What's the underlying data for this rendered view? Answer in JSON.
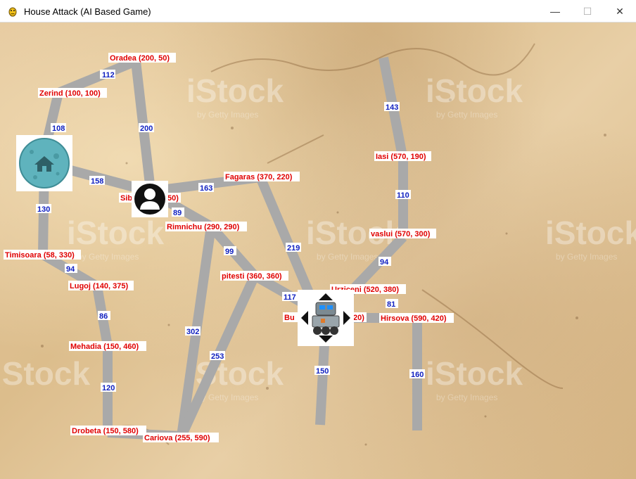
{
  "window": {
    "title": "House Attack (AI Based Game)",
    "minimize_glyph": "—",
    "maximize_glyph": "☐",
    "close_glyph": "✕"
  },
  "watermark": {
    "text": "iStock",
    "subtext": "by Getty Images"
  },
  "cities": [
    {
      "id": "oradea",
      "label": "Oradea (200, 50)"
    },
    {
      "id": "zerind",
      "label": "Zerind (100, 100)"
    },
    {
      "id": "arad",
      "label": ""
    },
    {
      "id": "sibiu",
      "label": "Sib"
    },
    {
      "id": "sibiu2",
      "label": "50)"
    },
    {
      "id": "timisoara",
      "label": "Timisoara (58, 330)"
    },
    {
      "id": "rimnichu",
      "label": "Rimnichu (290, 290)"
    },
    {
      "id": "fagaras",
      "label": "Fagaras (370, 220)"
    },
    {
      "id": "pitesti",
      "label": "pitesti (360, 360)"
    },
    {
      "id": "lugoj",
      "label": "Lugoj (140, 375)"
    },
    {
      "id": "mehadia",
      "label": "Mehadia (150, 460)"
    },
    {
      "id": "drobeta",
      "label": "Drobeta (150, 580)"
    },
    {
      "id": "cariova",
      "label": "Cariova (255, 590)"
    },
    {
      "id": "bucharest",
      "label": "Bu"
    },
    {
      "id": "bucharest2",
      "label": "20)"
    },
    {
      "id": "urziceni",
      "label": "Urziceni (520, 380)"
    },
    {
      "id": "hirsova",
      "label": "Hirsova (590, 420)"
    },
    {
      "id": "vaslui",
      "label": "vaslui (570, 300)"
    },
    {
      "id": "iasi",
      "label": "Iasi (570, 190)"
    }
  ],
  "edges": [
    {
      "id": "zerind-oradea",
      "weight": "112"
    },
    {
      "id": "arad-zerind",
      "weight": "108"
    },
    {
      "id": "oradea-sibiu",
      "weight": "200"
    },
    {
      "id": "arad-sibiu",
      "weight": "158"
    },
    {
      "id": "sibiu-fagaras",
      "weight": "163"
    },
    {
      "id": "sibiu-rimnichu",
      "weight": "89"
    },
    {
      "id": "arad-timisoara",
      "weight": "130"
    },
    {
      "id": "timisoara-lugoj",
      "weight": "94"
    },
    {
      "id": "lugoj-mehadia",
      "weight": "86"
    },
    {
      "id": "mehadia-drobeta",
      "weight": "120"
    },
    {
      "id": "drobeta-cariova",
      "weight": ""
    },
    {
      "id": "rimnichu-pitesti",
      "weight": "99"
    },
    {
      "id": "rimnichu-cariova",
      "weight": "302"
    },
    {
      "id": "pitesti-cariova",
      "weight": "253"
    },
    {
      "id": "fagaras-bucharest",
      "weight": "219"
    },
    {
      "id": "pitesti-bucharest",
      "weight": "117"
    },
    {
      "id": "bucharest-south",
      "weight": "150"
    },
    {
      "id": "urziceni-hirsova",
      "weight": "81"
    },
    {
      "id": "hirsova-south",
      "weight": "160"
    },
    {
      "id": "vaslui-urziceni",
      "weight": "94"
    },
    {
      "id": "iasi-vaslui",
      "weight": "110"
    },
    {
      "id": "north-iasi",
      "weight": "143"
    }
  ],
  "pieces": {
    "house": "house-icon",
    "player": "player-icon",
    "robot": "robot-icon"
  },
  "colors": {
    "road": "#a9a9a9",
    "city_text": "#e00000",
    "weight_text": "#1020c0",
    "house_circle": "#5fb3bd"
  }
}
